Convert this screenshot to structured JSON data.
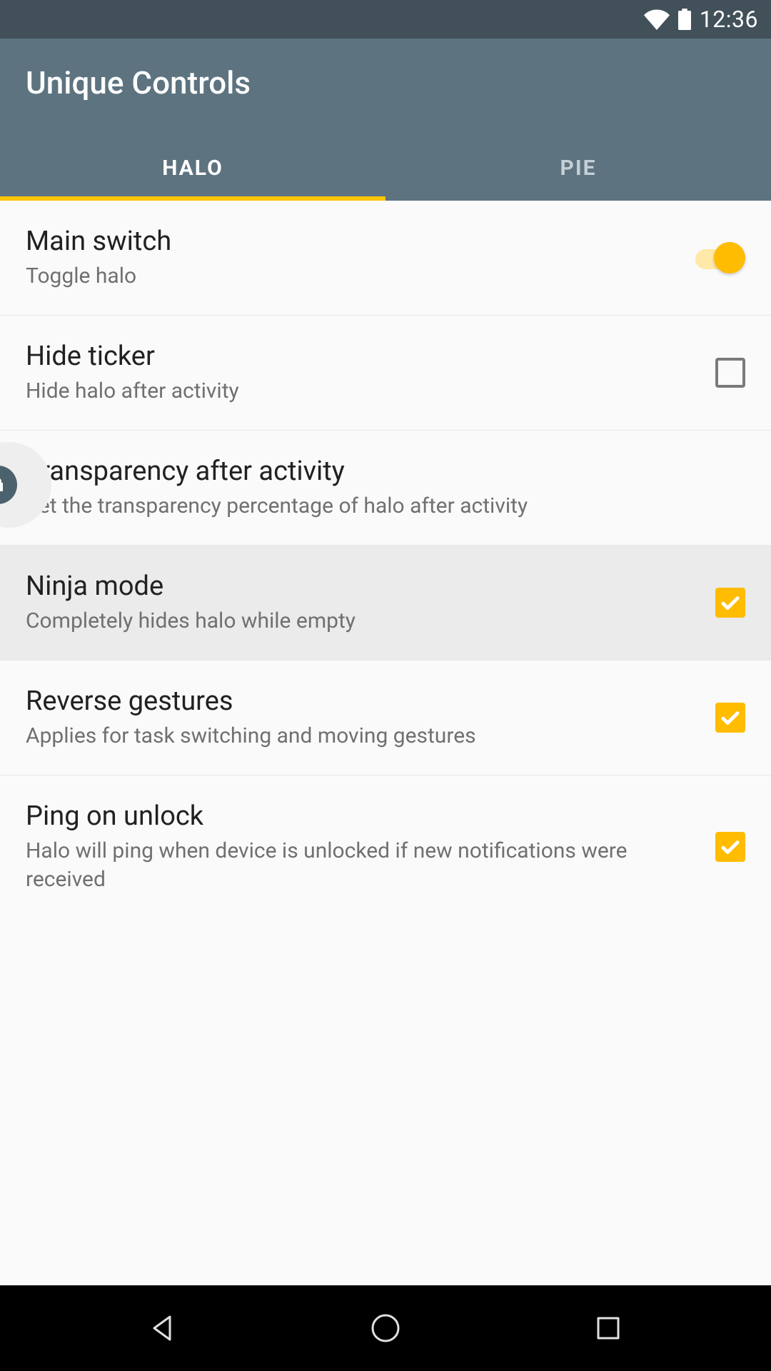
{
  "status_bar": {
    "time": "12:36"
  },
  "header": {
    "title": "Unique Controls"
  },
  "tabs": {
    "halo": "HALO",
    "pie": "PIE",
    "active": "halo"
  },
  "settings": {
    "main_switch": {
      "title": "Main switch",
      "sub": "Toggle halo",
      "on": true
    },
    "hide_ticker": {
      "title": "Hide ticker",
      "sub": "Hide halo after activity",
      "checked": false
    },
    "transparency": {
      "title": "Transparency after activity",
      "sub": "Set the transparency percentage of halo after activity"
    },
    "ninja_mode": {
      "title": "Ninja mode",
      "sub": "Completely hides halo while empty",
      "checked": true
    },
    "reverse_gestures": {
      "title": "Reverse gestures",
      "sub": "Applies for task switching and moving gestures",
      "checked": true
    },
    "ping_on_unlock": {
      "title": "Ping on unlock",
      "sub": "Halo will ping when device is unlocked if new notifications were received",
      "checked": true
    }
  },
  "colors": {
    "header_bg": "#5d7380",
    "status_bg": "#415059",
    "accent": "#ffbc00",
    "tab_indicator": "#ffc400",
    "text_primary": "#212121",
    "text_secondary": "#707070",
    "highlight_bg": "#ebebeb",
    "checkbox_border": "#7a7a7a"
  }
}
